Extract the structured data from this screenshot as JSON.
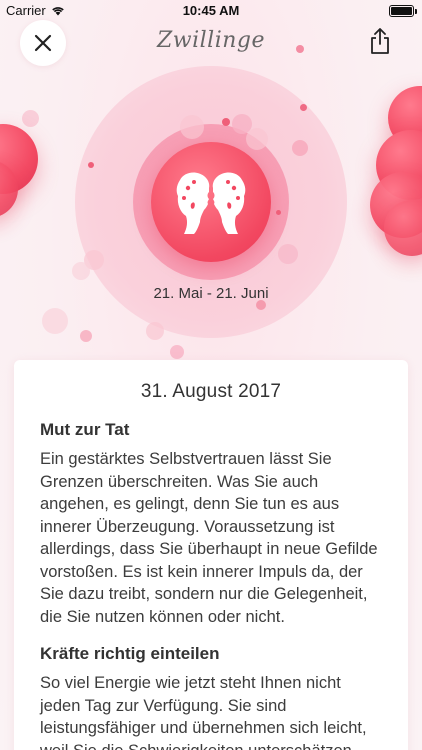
{
  "status_bar": {
    "carrier": "Carrier",
    "time": "10:45 AM"
  },
  "nav": {
    "title": "Zwillinge",
    "close_icon": "close-icon",
    "share_icon": "share-icon"
  },
  "sign": {
    "icon": "gemini-twins-icon",
    "date_range": "21. Mai - 21. Juni"
  },
  "colors": {
    "accent": "#f24760",
    "halo": "#f8c0cf",
    "background": "#fbeef1"
  },
  "card": {
    "date": "31. August 2017",
    "sections": [
      {
        "heading": "Mut zur Tat",
        "text": "Ein gestärktes Selbstvertrauen lässt Sie Grenzen überschreiten. Was Sie auch angehen, es gelingt, denn Sie tun es aus innerer Überzeugung. Voraussetzung ist allerdings, dass Sie überhaupt in neue Gefilde vorstoßen. Es ist kein innerer Impuls da, der Sie dazu treibt, sondern nur die Gelegenheit, die Sie nutzen können oder nicht."
      },
      {
        "heading": "Kräfte richtig einteilen",
        "text": "So viel Energie wie jetzt steht Ihnen nicht jeden Tag zur Verfügung. Sie sind leistungsfähiger und übernehmen sich leicht, weil Sie die Schwierigkeiten unterschätzen."
      }
    ]
  }
}
